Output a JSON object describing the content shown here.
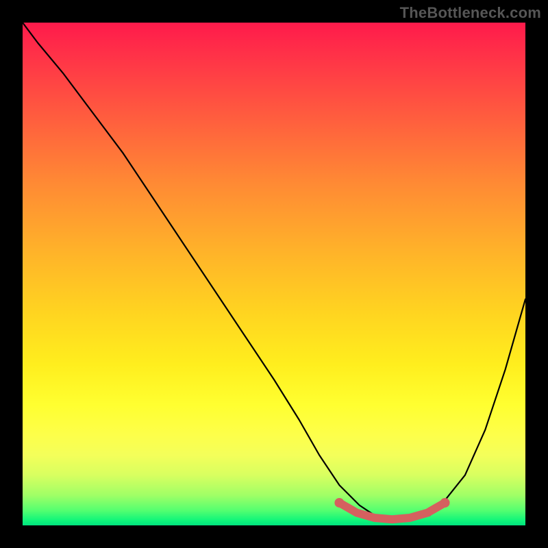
{
  "watermark": "TheBottleneck.com",
  "colors": {
    "page_bg": "#000000",
    "watermark": "#565656",
    "curve": "#000000",
    "marker": "#d5605f",
    "gradient_top": "#ff1a4b",
    "gradient_bottom": "#00e27e"
  },
  "chart_data": {
    "type": "line",
    "title": "",
    "xlabel": "",
    "ylabel": "",
    "xlim": [
      0,
      100
    ],
    "ylim": [
      0,
      100
    ],
    "grid": false,
    "series": [
      {
        "name": "bottleneck-curve",
        "x": [
          0,
          3,
          8,
          14,
          20,
          26,
          32,
          38,
          44,
          50,
          55,
          59,
          63,
          67,
          70,
          73,
          77,
          81,
          84,
          88,
          92,
          96,
          100
        ],
        "y": [
          100,
          96,
          90,
          82,
          74,
          65,
          56,
          47,
          38,
          29,
          21,
          14,
          8,
          4,
          2,
          1,
          1,
          2,
          5,
          10,
          19,
          31,
          45
        ]
      }
    ],
    "annotations": [
      {
        "name": "optimal-valley",
        "x_range": [
          63,
          84
        ],
        "y": [
          4.5,
          2.5,
          1.5,
          1.2,
          1.5,
          2.5,
          4.5
        ]
      }
    ]
  }
}
